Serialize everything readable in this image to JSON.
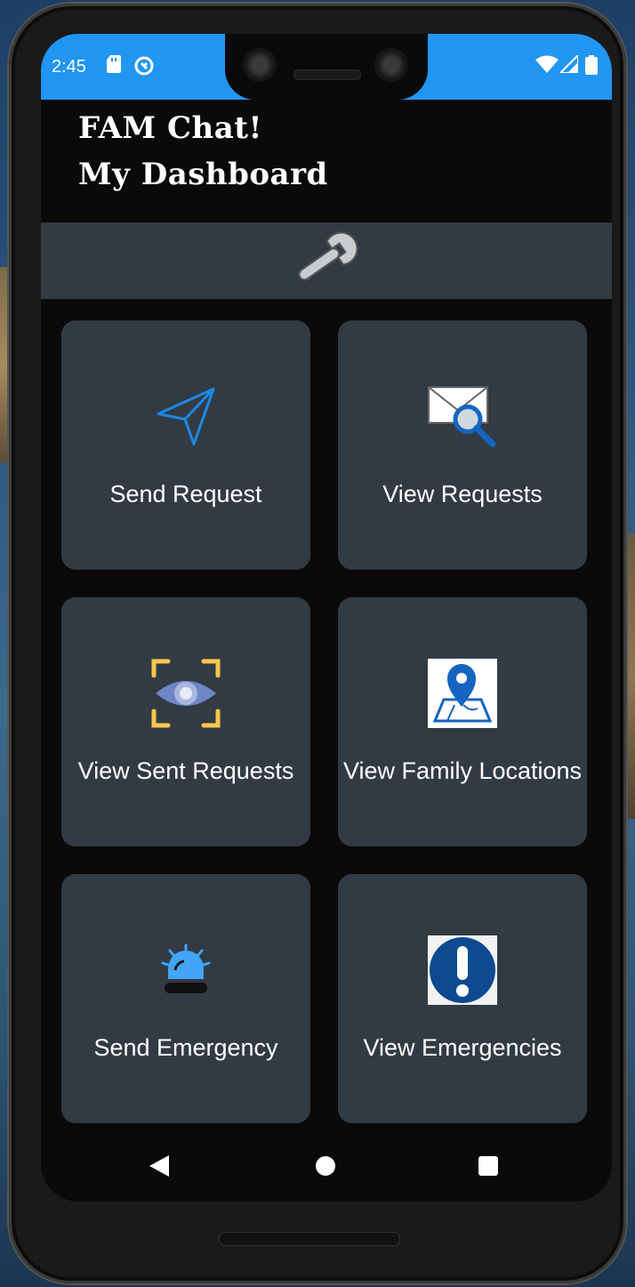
{
  "status_bar": {
    "time": "2:45",
    "left_icons": [
      "sd-card-icon",
      "sync-icon"
    ],
    "right_icons": [
      "wifi-icon",
      "signal-icon",
      "battery-icon"
    ],
    "color": "#2196f3"
  },
  "header": {
    "line1": "FAM Chat!",
    "line2": "My Dashboard"
  },
  "toolbar": {
    "icon": "wrench-icon"
  },
  "tiles": [
    {
      "label": "Send Request",
      "icon": "send-icon"
    },
    {
      "label": "View Requests",
      "icon": "envelope-search-icon"
    },
    {
      "label": "View Sent Requests",
      "icon": "eye-scan-icon"
    },
    {
      "label": "View Family Locations",
      "icon": "map-pin-icon"
    },
    {
      "label": "Send Emergency",
      "icon": "siren-icon"
    },
    {
      "label": "View Emergencies",
      "icon": "exclamation-icon"
    }
  ],
  "nav": {
    "back": "back-icon",
    "home": "home-icon",
    "recent": "recent-apps-icon"
  },
  "colors": {
    "tile_bg": "#323b44",
    "screen_bg": "#0a0a0a",
    "accent_blue": "#2196f3",
    "icon_blue": "#1976d2",
    "eye_frame": "#f9c74f"
  }
}
